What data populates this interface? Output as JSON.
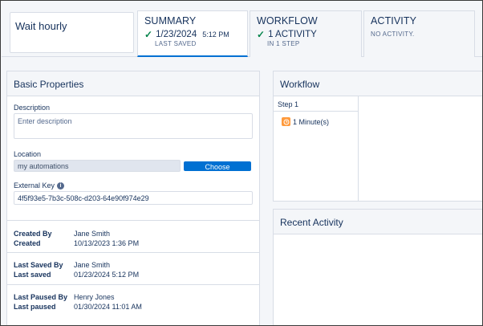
{
  "header": {
    "automation_name": "Wait hourly",
    "tabs": [
      {
        "title": "SUMMARY",
        "main": "1/23/2024",
        "main_small": "5:12 PM",
        "sub": "LAST SAVED",
        "checked": true
      },
      {
        "title": "WORKFLOW",
        "main": "1 ACTIVITY",
        "sub": "IN 1 STEP",
        "checked": true
      },
      {
        "title": "ACTIVITY",
        "main": "",
        "sub": "NO ACTIVITY.",
        "checked": false
      }
    ]
  },
  "basic": {
    "title": "Basic Properties",
    "description_label": "Description",
    "description_placeholder": "Enter description",
    "location_label": "Location",
    "location_value": "my automations",
    "choose_label": "Choose",
    "external_key_label": "External Key",
    "external_key_value": "4f5f93e5-7b3c-508c-d203-64e90f974e29",
    "meta": [
      {
        "k1": "Created By",
        "v1": "Jane Smith",
        "k2": "Created",
        "v2": "10/13/2023 1:36 PM"
      },
      {
        "k1": "Last Saved By",
        "v1": "Jane Smith",
        "k2": "Last saved",
        "v2": "01/23/2024 5:12 PM"
      },
      {
        "k1": "Last Paused By",
        "v1": "Henry Jones",
        "k2": "Last paused",
        "v2": "01/30/2024 11:01 AM"
      }
    ]
  },
  "workflow": {
    "title": "Workflow",
    "step_label": "Step 1",
    "activity_label": "1 Minute(s)",
    "activity_icon": "clock-icon"
  },
  "recent": {
    "title": "Recent Activity"
  },
  "colors": {
    "accent": "#0070d2",
    "success": "#04844b",
    "wait_activity": "#ff9a3c"
  }
}
